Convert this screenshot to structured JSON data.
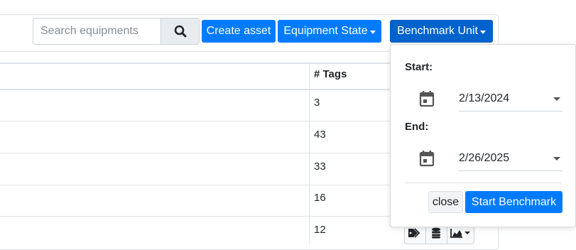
{
  "toolbar": {
    "search_placeholder": "Search equipments",
    "search_value": "",
    "create_label": "Create asset",
    "state_label": "Equipment State",
    "benchmark_label": "Benchmark Unit"
  },
  "table": {
    "headers": {
      "tags": "# Tags"
    },
    "rows": [
      {
        "tags": "3"
      },
      {
        "tags": "43"
      },
      {
        "tags": "33"
      },
      {
        "tags": "16"
      },
      {
        "tags": "12"
      }
    ]
  },
  "icons": {
    "search": "search-icon",
    "calendar": "calendar-icon",
    "tags": "tags-icon",
    "database": "database-icon",
    "chart": "area-chart-icon"
  },
  "benchmark_dropdown": {
    "start_label": "Start:",
    "start_date": "2/13/2024",
    "end_label": "End:",
    "end_date": "2/26/2025",
    "close_label": "close",
    "start_button_label": "Start Benchmark"
  },
  "colors": {
    "primary": "#007bff",
    "primary_active": "#0062cc",
    "border": "#dee2e6"
  }
}
